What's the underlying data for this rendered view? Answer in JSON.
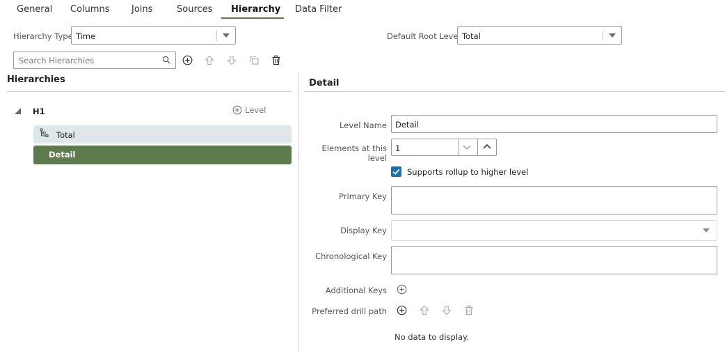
{
  "tabs": [
    {
      "label": "General"
    },
    {
      "label": "Columns"
    },
    {
      "label": "Joins"
    },
    {
      "label": "Sources"
    },
    {
      "label": "Hierarchy",
      "active": true
    },
    {
      "label": "Data Filter"
    }
  ],
  "top": {
    "hierarchy_type_label": "Hierarchy Type",
    "hierarchy_type_value": "Time",
    "default_root_label": "Default Root Level",
    "default_root_value": "Total"
  },
  "search": {
    "placeholder": "Search Hierarchies"
  },
  "left": {
    "title": "Hierarchies",
    "hierarchy_name": "H1",
    "add_level_label": "Level",
    "levels": [
      {
        "label": "Total"
      },
      {
        "label": "Detail",
        "selected": true
      }
    ]
  },
  "detail": {
    "title": "Detail",
    "level_name_label": "Level Name",
    "level_name_value": "Detail",
    "elements_label": "Elements at this level",
    "elements_value": "1",
    "rollup_label": "Supports rollup to higher level",
    "rollup_checked": true,
    "primary_key_label": "Primary Key",
    "display_key_label": "Display Key",
    "chronological_key_label": "Chronological Key",
    "additional_keys_label": "Additional Keys",
    "drill_path_label": "Preferred drill path",
    "no_data": "No data to display."
  },
  "colors": {
    "accent": "#5e7b4d",
    "total_row_bg": "#dfe7ea",
    "checkbox": "#1f6fb5"
  },
  "icons": [
    "search-icon",
    "add-icon",
    "arrow-up-icon",
    "arrow-down-icon",
    "copy-icon",
    "trash-icon",
    "hierarchy-level-icon",
    "caret-down-icon",
    "chevron-down-icon",
    "chevron-up-icon",
    "check-icon",
    "collapse-triangle-icon"
  ]
}
